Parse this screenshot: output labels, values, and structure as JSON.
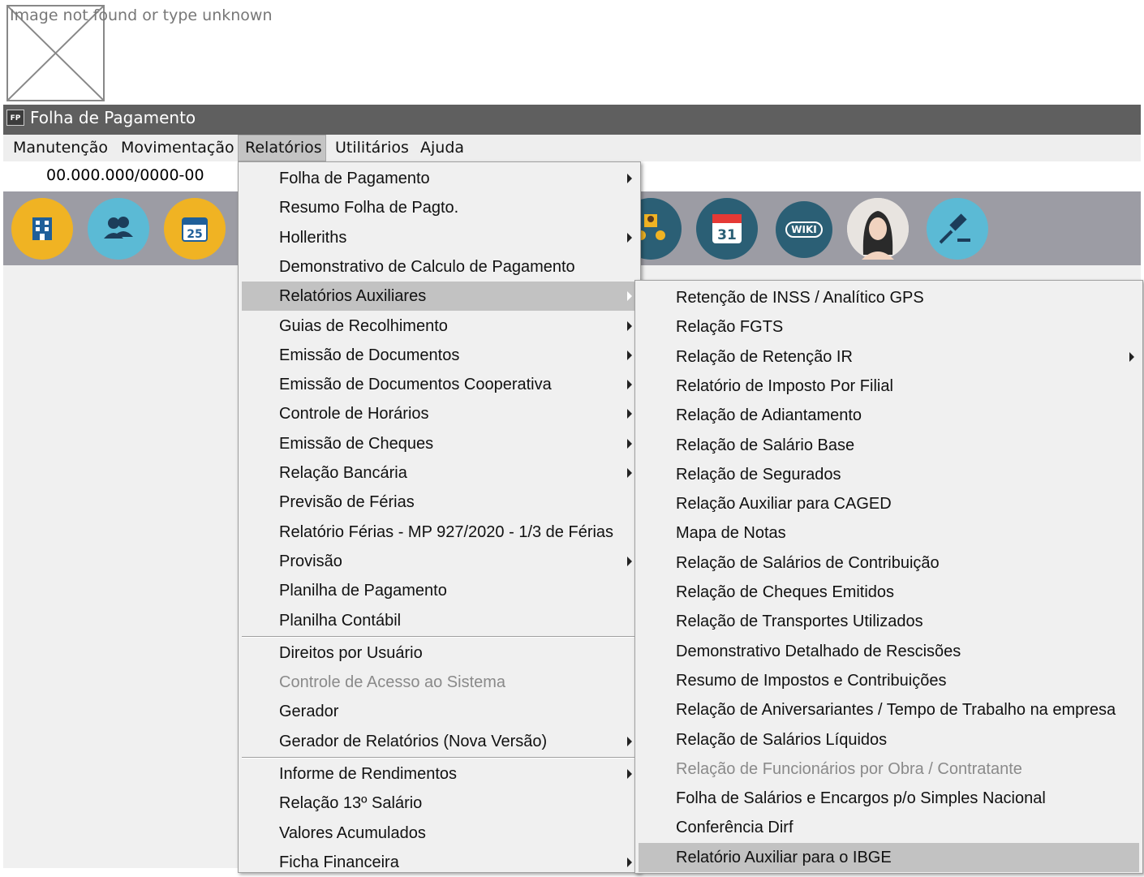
{
  "broken_image_text": "Image not found or type unknown",
  "window": {
    "icon_text": "FP",
    "title": "Folha de Pagamento"
  },
  "menubar": {
    "items": [
      "Manutenção",
      "Movimentação",
      "Relatórios",
      "Utilitários",
      "Ajuda"
    ],
    "active": "Relatórios"
  },
  "company": {
    "cnpj": "00.000.000/0000-00"
  },
  "toolbar": {
    "icons": [
      {
        "name": "building-icon",
        "color": "#f0b323"
      },
      {
        "name": "users-icon",
        "color": "#5bbad5"
      },
      {
        "name": "calendar-25-icon",
        "color": "#f0b323",
        "text": "25"
      },
      {
        "name": "org-chart-icon",
        "color": "#2b5f75"
      },
      {
        "name": "calendar-31-icon",
        "color": "#2b5f75",
        "text": "31"
      },
      {
        "name": "wiki-icon",
        "color": "#2b5f75",
        "text": "WIKI"
      },
      {
        "name": "assistant-avatar-icon",
        "color": "#d8d8d8"
      },
      {
        "name": "gavel-icon",
        "color": "#5bbad5"
      }
    ]
  },
  "relatorios_menu": {
    "items": [
      {
        "label": "Folha de Pagamento",
        "submenu": true
      },
      {
        "label": "Resumo Folha de Pagto.",
        "submenu": false
      },
      {
        "label": "Holleriths",
        "submenu": true
      },
      {
        "label": "Demonstrativo de Calculo de Pagamento",
        "submenu": false
      },
      {
        "label": "Relatórios Auxiliares",
        "submenu": true,
        "highlighted": true
      },
      {
        "label": "Guias de Recolhimento",
        "submenu": true
      },
      {
        "label": "Emissão de Documentos",
        "submenu": true
      },
      {
        "label": "Emissão de Documentos Cooperativa",
        "submenu": true
      },
      {
        "label": "Controle de Horários",
        "submenu": true
      },
      {
        "label": "Emissão de Cheques",
        "submenu": true
      },
      {
        "label": "Relação Bancária",
        "submenu": true
      },
      {
        "label": "Previsão de Férias",
        "submenu": false
      },
      {
        "label": "Relatório Férias - MP 927/2020 - 1/3 de Férias",
        "submenu": false
      },
      {
        "label": "Provisão",
        "submenu": true
      },
      {
        "label": "Planilha de Pagamento",
        "submenu": false
      },
      {
        "label": "Planilha Contábil",
        "submenu": false
      },
      {
        "separator": true
      },
      {
        "label": "Direitos por Usuário",
        "submenu": false
      },
      {
        "label": "Controle de Acesso ao Sistema",
        "submenu": false,
        "disabled": true
      },
      {
        "label": "Gerador",
        "submenu": false
      },
      {
        "label": "Gerador de Relatórios (Nova Versão)",
        "submenu": true
      },
      {
        "separator": true
      },
      {
        "label": "Informe de Rendimentos",
        "submenu": true
      },
      {
        "label": "Relação 13º Salário",
        "submenu": false
      },
      {
        "label": "Valores Acumulados",
        "submenu": false
      },
      {
        "label": "Ficha Financeira",
        "submenu": true
      }
    ]
  },
  "auxiliares_menu": {
    "items": [
      {
        "label": "Retenção de INSS / Analítico GPS",
        "submenu": false
      },
      {
        "label": "Relação FGTS",
        "submenu": false
      },
      {
        "label": "Relação de Retenção IR",
        "submenu": true
      },
      {
        "label": "Relatório de Imposto Por Filial",
        "submenu": false
      },
      {
        "label": "Relação de Adiantamento",
        "submenu": false
      },
      {
        "label": "Relação de Salário Base",
        "submenu": false
      },
      {
        "label": "Relação de Segurados",
        "submenu": false
      },
      {
        "label": "Relação Auxiliar para CAGED",
        "submenu": false
      },
      {
        "label": "Mapa de Notas",
        "submenu": false
      },
      {
        "label": "Relação de Salários de Contribuição",
        "submenu": false
      },
      {
        "label": "Relação de Cheques Emitidos",
        "submenu": false
      },
      {
        "label": "Relação de Transportes Utilizados",
        "submenu": false
      },
      {
        "label": "Demonstrativo Detalhado de Rescisões",
        "submenu": false
      },
      {
        "label": "Resumo de Impostos e Contribuições",
        "submenu": false
      },
      {
        "label": "Relação de Aniversariantes / Tempo de Trabalho na empresa",
        "submenu": false
      },
      {
        "label": "Relação de Salários Líquidos",
        "submenu": false
      },
      {
        "label": "Relação de Funcionários por Obra / Contratante",
        "submenu": false,
        "disabled": true
      },
      {
        "label": "Folha de Salários e Encargos p/o Simples Nacional",
        "submenu": false
      },
      {
        "label": "Conferência Dirf",
        "submenu": false
      },
      {
        "label": "Relatório Auxiliar para o IBGE",
        "submenu": false,
        "highlighted": true
      }
    ]
  }
}
